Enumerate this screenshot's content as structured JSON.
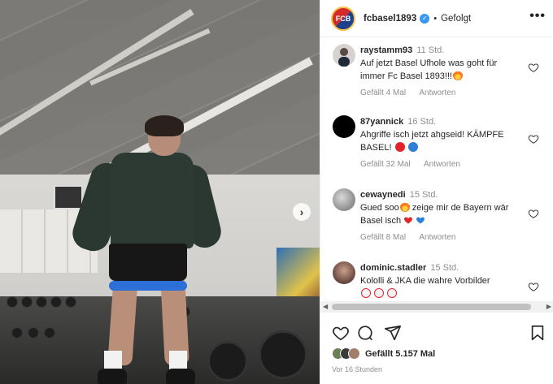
{
  "header": {
    "username": "fcbasel1893",
    "verified_mark": "✓",
    "separator": "•",
    "following_label": "Gefolgt",
    "more_label": "•••",
    "avatar_text": "FCB"
  },
  "photo": {
    "next_label": "›"
  },
  "comments": [
    {
      "user": "raystamm93",
      "time": "11 Std.",
      "text": "Auf jetzt Basel Ufhole was goht für immer Fc Basel 1893!!!",
      "likes": "Gefällt 4 Mal",
      "reply": "Antworten",
      "avatar_color": "#d8d2cf",
      "emojis": [
        "fire"
      ]
    },
    {
      "user": "87yannick",
      "time": "16 Std.",
      "text": "Ahgriffe isch jetzt ahgseid! KÄMPFE BASEL!",
      "likes": "Gefällt 32 Mal",
      "reply": "Antworten",
      "avatar_color": "#000000",
      "emojis": [
        "red-circle",
        "blue-circle"
      ]
    },
    {
      "user": "cewaynedi",
      "time": "15 Std.",
      "text_before": "Gued soo",
      "text": " zeige mir de Bayern wär Basel isch",
      "likes": "Gefällt 8 Mal",
      "reply": "Antworten",
      "avatar_color": "#8a8a8a",
      "emojis": [
        "red-heart",
        "blue-heart"
      ]
    },
    {
      "user": "dominic.stadler",
      "time": "15 Std.",
      "text": "Kololli & JKA die wahre Vorbilder",
      "likes": "",
      "reply": "",
      "avatar_color": "#6b2a2a",
      "emojis": [
        "clown",
        "clown",
        "clown"
      ]
    }
  ],
  "scrollbar": {
    "left_arrow": "◀",
    "right_arrow": "▶"
  },
  "footer": {
    "likes_text": "Gefällt 5.157 Mal",
    "timestamp": "Vor 16 Stunden"
  },
  "colors": {
    "link_blue": "#3897f0",
    "muted": "#8e8e8e",
    "text": "#262626",
    "band_blue": "#2c6fd6"
  }
}
